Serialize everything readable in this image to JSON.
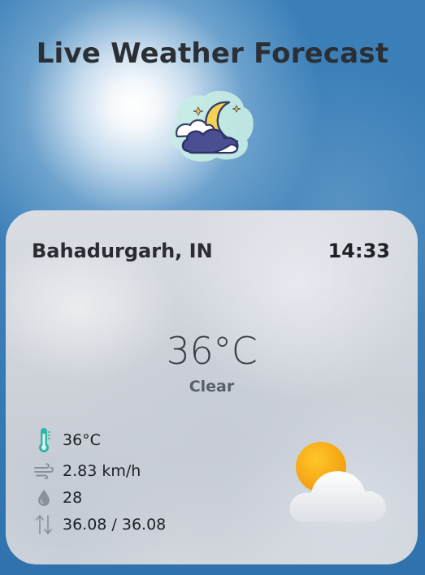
{
  "header": {
    "title": "Live Weather Forecast",
    "logo_icon": "moon-cloud-icon"
  },
  "card": {
    "city": "Bahadurgarh, IN",
    "time": "14:33",
    "temperature": "36°C",
    "condition": "Clear",
    "stats": {
      "temperature": {
        "icon": "thermometer-icon",
        "value": "36°C"
      },
      "wind": {
        "icon": "wind-icon",
        "value": "2.83 km/h"
      },
      "humidity": {
        "icon": "droplet-icon",
        "value": "28"
      },
      "min_max": {
        "icon": "min-max-arrows-icon",
        "value": "36.08 / 36.08"
      }
    },
    "illustration_icon": "sun-behind-cloud-icon"
  },
  "colors": {
    "title_text": "#2b2e33",
    "thermometer": "#2fb7a5",
    "sun": "#f6a614",
    "icon_grey": "#8a8f98"
  }
}
